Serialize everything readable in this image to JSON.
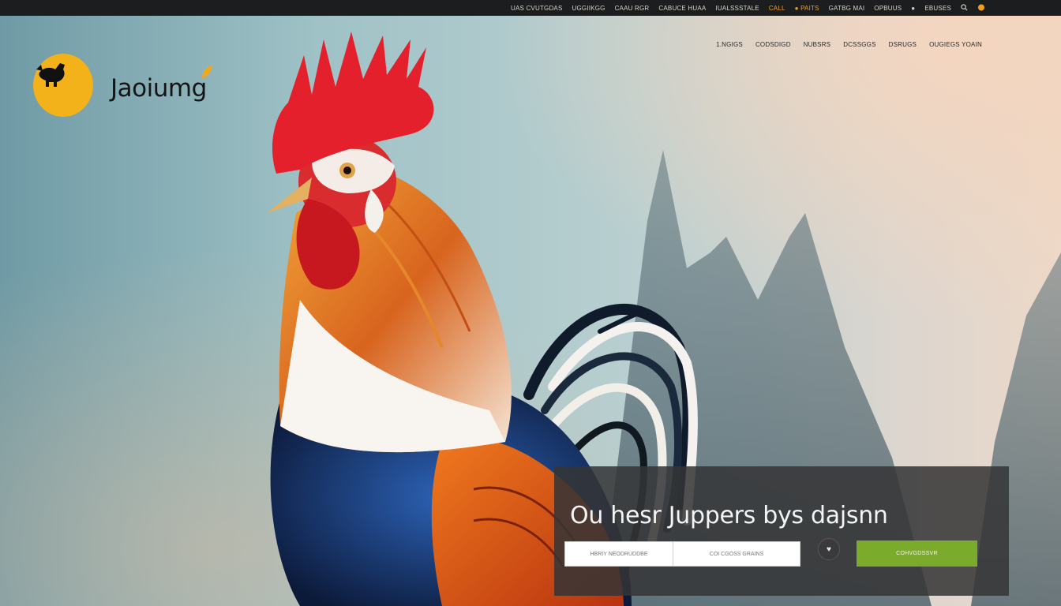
{
  "topbar": {
    "items": [
      "UAS CVUTGDAS",
      "UGGIIKGG",
      "CAAU RGR",
      "CABUCE HUAA",
      "IUALSSSTALE",
      "CALL",
      "● PAITS",
      "GATBG MAI",
      "OPBUUS",
      "●",
      "EBUSES"
    ],
    "search_icon": "search-icon",
    "cart_icon": "cart-icon"
  },
  "brand": {
    "name": "Jaoiumg",
    "logo_icon": "rooster-icon",
    "logo_color": "#f3b11a"
  },
  "nav": {
    "items": [
      "1.NGIGS",
      "CODSDIGD",
      "NUBSRS",
      "DCSSGGS",
      "DSRUGS",
      "OUGIEGS YOAIN"
    ]
  },
  "hero": {
    "headline": "Ou hesr Juppers bys dajsnn",
    "field1_placeholder": "HBRIY NEODRUDDBE",
    "field2_placeholder": "COI CGOSS GRAINS",
    "favorite_icon": "heart-icon",
    "cta_label": "COHVGDSSVR",
    "cta_color": "#7aab2b"
  }
}
